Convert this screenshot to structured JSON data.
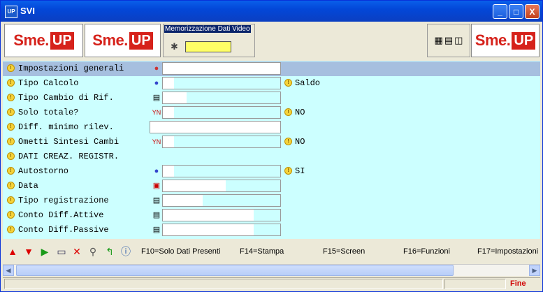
{
  "window": {
    "title": "SVI",
    "app_icon": "UP",
    "minimize": "_",
    "maximize": "□",
    "close": "X"
  },
  "header": {
    "logo_sme": "Sme.",
    "logo_up": "UP",
    "memo_label": "Memorizzazione Dati Video",
    "memo_value": ""
  },
  "form": {
    "rows": [
      {
        "label": "Impostazioni generali",
        "value": ""
      },
      {
        "label": "Tipo Calcolo",
        "value": "Saldo"
      },
      {
        "label": "Tipo Cambio di Rif.",
        "value": ""
      },
      {
        "label": "Solo totale?",
        "value": "NO"
      },
      {
        "label": "Diff. minimo rilev.",
        "value": ""
      },
      {
        "label": "Ometti Sintesi Cambi",
        "value": "NO"
      },
      {
        "label": "DATI CREAZ. REGISTR.",
        "value": ""
      },
      {
        "label": " Autostorno",
        "value": "SI"
      },
      {
        "label": " Data",
        "value": ""
      },
      {
        "label": " Tipo registrazione",
        "value": ""
      },
      {
        "label": " Conto Diff.Attive",
        "value": ""
      },
      {
        "label": " Conto Diff.Passive",
        "value": ""
      }
    ]
  },
  "toolbar": {
    "fkeys": [
      "F10=Solo Dati Presenti",
      "F14=Stampa",
      "F15=Screen",
      "F16=Funzioni",
      "F17=Impostazioni"
    ]
  },
  "status": {
    "message": "Fine"
  },
  "colors": {
    "accent": "#D6221B",
    "form_bg": "#CCFFFF",
    "selected_row": "#A6BFDF",
    "status_text": "#D00000"
  }
}
